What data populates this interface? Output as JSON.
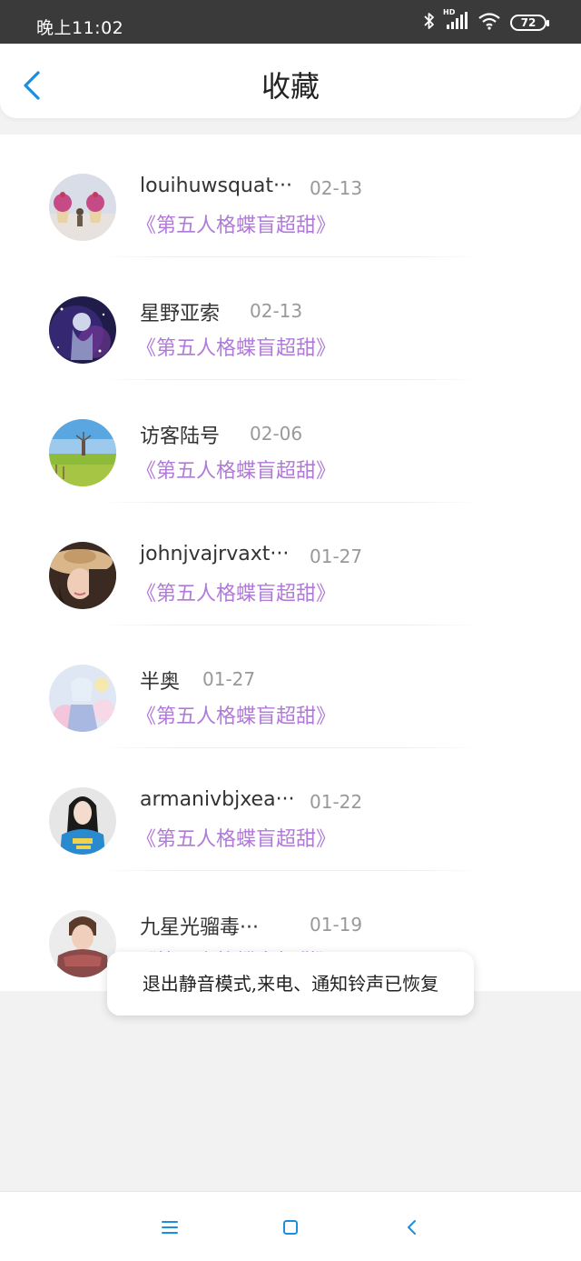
{
  "status_bar": {
    "time": "晚上11:02",
    "battery": "72",
    "network_label": "HD",
    "icons": [
      "bluetooth-icon",
      "signal-icon",
      "wifi-icon",
      "battery-icon"
    ]
  },
  "header": {
    "title": "收藏",
    "back_icon": "chevron-left-icon"
  },
  "colors": {
    "accent_blue": "#1a8fe0",
    "link_purple": "#b07ad8",
    "nav_blue": "#1a8fe0"
  },
  "favorites": [
    {
      "name": "louihuwsquat···",
      "date": "02-13",
      "title": "《第五人格蝶盲超甜》"
    },
    {
      "name": "星野亚索",
      "date": "02-13",
      "title": "《第五人格蝶盲超甜》"
    },
    {
      "name": "访客陆号",
      "date": "02-06",
      "title": "《第五人格蝶盲超甜》"
    },
    {
      "name": "johnjvajrvaxt···",
      "date": "01-27",
      "title": "《第五人格蝶盲超甜》"
    },
    {
      "name": "半奥",
      "date": "01-27",
      "title": "《第五人格蝶盲超甜》"
    },
    {
      "name": "armanivbjxea···",
      "date": "01-22",
      "title": "《第五人格蝶盲超甜》"
    },
    {
      "name": "九星光骝毒···",
      "date": "01-19",
      "title": "《第五人格蝶盲超甜》"
    }
  ],
  "toast": {
    "message": "退出静音模式,来电、通知铃声已恢复"
  },
  "nav_bar": {
    "icons": [
      "menu-icon",
      "home-square-icon",
      "back-triangle-icon"
    ]
  }
}
